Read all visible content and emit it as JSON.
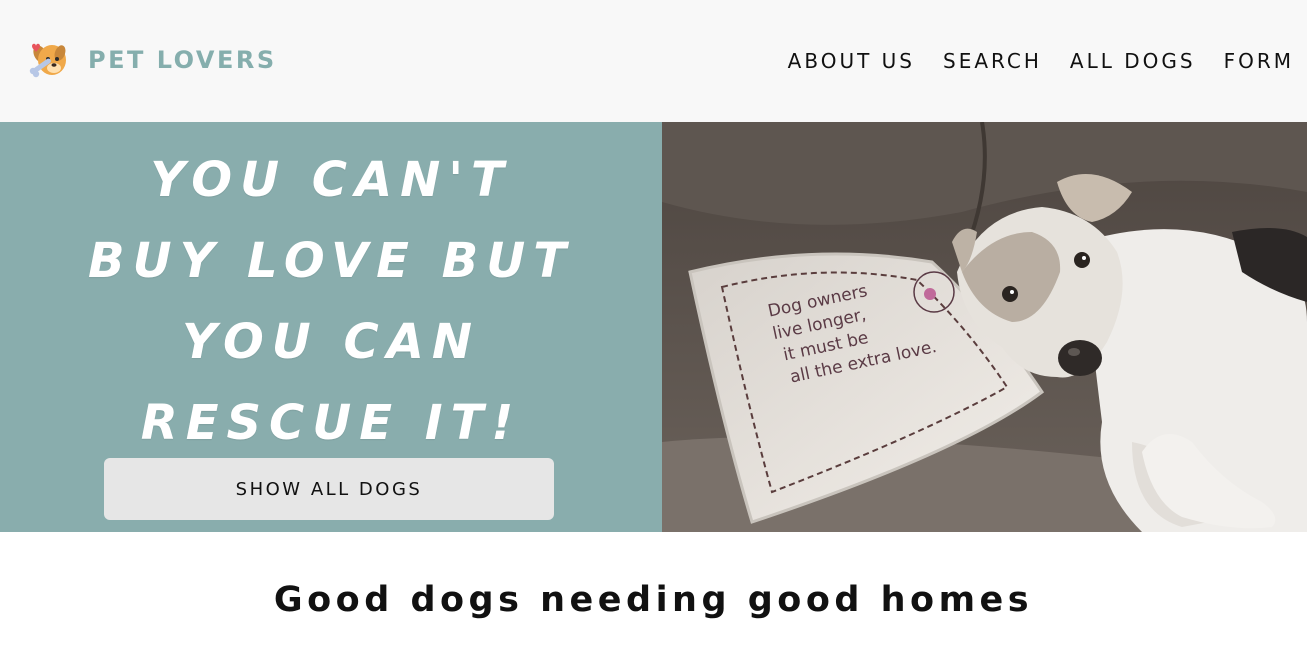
{
  "header": {
    "brand_name": "PET LOVERS",
    "brand_icon": "dog-with-bone-icon",
    "nav": [
      {
        "label": "ABOUT US"
      },
      {
        "label": "SEARCH"
      },
      {
        "label": "ALL DOGS"
      },
      {
        "label": "FORM"
      }
    ]
  },
  "hero": {
    "title_lines": [
      "YOU CAN'T",
      "BUY LOVE BUT",
      "YOU CAN",
      "RESCUE IT!"
    ],
    "button_label": "SHOW ALL DOGS",
    "image": {
      "description_icon": "dog-on-pillow-photo",
      "pillow_text": [
        "Dog owners",
        "live longer,",
        "it must be",
        "all the extra love."
      ]
    }
  },
  "section": {
    "heading": "Good dogs needing good homes"
  },
  "colors": {
    "header_bg": "#f8f8f8",
    "brand": "#85aead",
    "hero_panel": "#89adad",
    "button_bg": "#e6e6e6"
  }
}
